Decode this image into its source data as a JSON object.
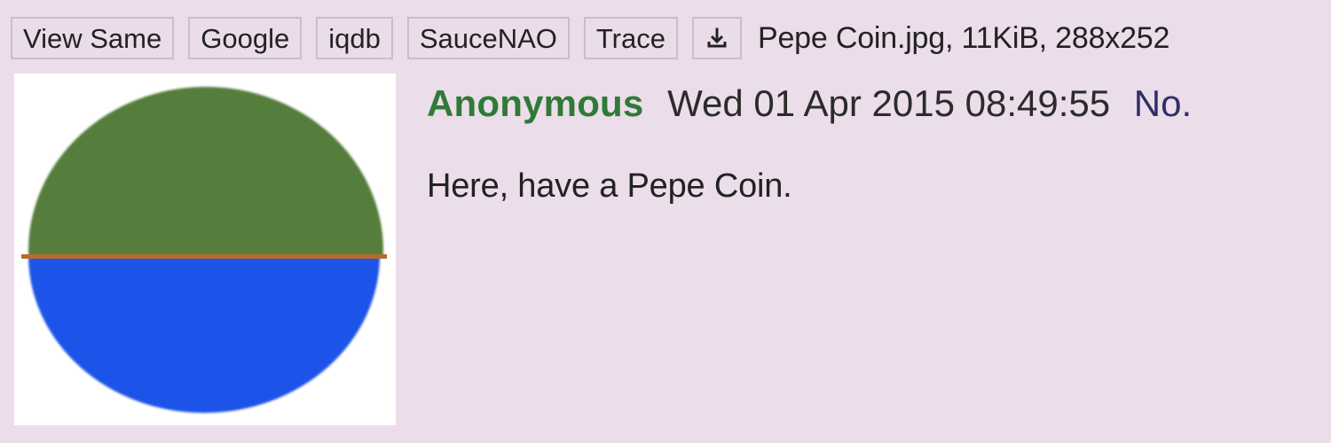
{
  "toolbar": {
    "buttons": [
      {
        "label": "View Same"
      },
      {
        "label": "Google"
      },
      {
        "label": "iqdb"
      },
      {
        "label": "SauceNAO"
      },
      {
        "label": "Trace"
      }
    ],
    "download_icon": "download-icon"
  },
  "file": {
    "info": "Pepe Coin.jpg, 11KiB, 288x252"
  },
  "post": {
    "name": "Anonymous",
    "date": "Wed 01 Apr 2015 08:49:55",
    "number_label": "No.",
    "message": "Here, have a Pepe Coin."
  },
  "colors": {
    "background": "#ebdde9",
    "name": "#2f7a36",
    "post_number": "#2f2f68",
    "coin_top": "#547d3a",
    "coin_bottom": "#1f52e8",
    "coin_line": "#b86b2d"
  }
}
